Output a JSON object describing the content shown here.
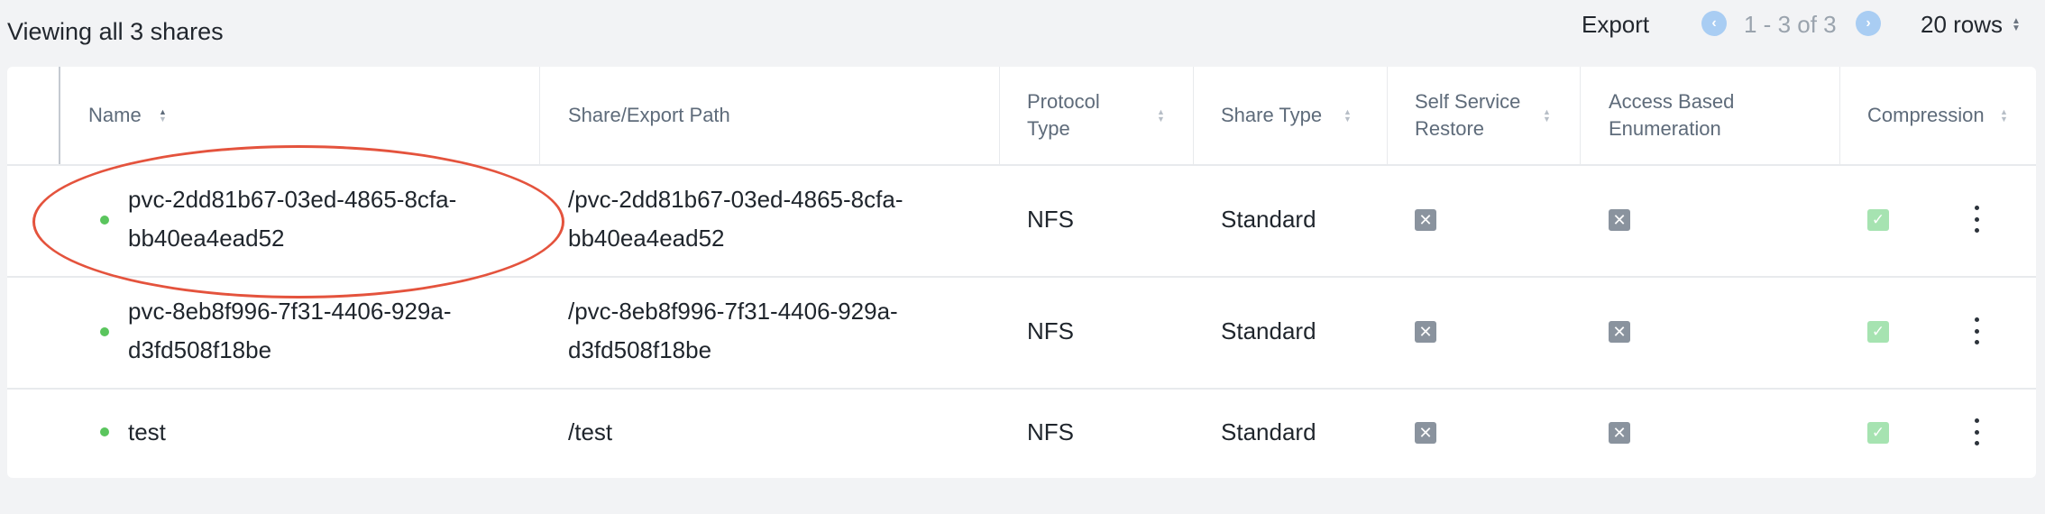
{
  "header": {
    "title": "Viewing all 3 shares",
    "export_label": "Export",
    "page_info": "1 - 3 of 3",
    "rows_label": "20 rows",
    "prev_icon": "chevron-left-icon",
    "next_icon": "chevron-right-icon"
  },
  "table": {
    "columns": [
      {
        "key": "name",
        "label": "Name",
        "sorted": "ascending"
      },
      {
        "key": "path",
        "label": "Share/Export Path"
      },
      {
        "key": "protocol",
        "label": "Protocol Type"
      },
      {
        "key": "share_type",
        "label": "Share Type"
      },
      {
        "key": "ssr",
        "label": "Self Service Restore"
      },
      {
        "key": "abe",
        "label": "Access Based Enumeration"
      },
      {
        "key": "compression",
        "label": "Compression"
      }
    ],
    "rows": [
      {
        "status": "active",
        "name_line1": "pvc-2dd81b67-03ed-4865-8cfa-",
        "name_line2": "bb40ea4ead52",
        "path_line1": "/pvc-2dd81b67-03ed-4865-8cfa-",
        "path_line2": "bb40ea4ead52",
        "protocol": "NFS",
        "share_type": "Standard",
        "ssr": false,
        "abe": false,
        "compression": true
      },
      {
        "status": "active",
        "name_line1": "pvc-8eb8f996-7f31-4406-929a-",
        "name_line2": "d3fd508f18be",
        "path_line1": "/pvc-8eb8f996-7f31-4406-929a-",
        "path_line2": "d3fd508f18be",
        "protocol": "NFS",
        "share_type": "Standard",
        "ssr": false,
        "abe": false,
        "compression": true
      },
      {
        "status": "active",
        "name_line1": "test",
        "path_line1": "/test",
        "protocol": "NFS",
        "share_type": "Standard",
        "ssr": false,
        "abe": false,
        "compression": true
      }
    ]
  },
  "colors": {
    "status_active": "#5ac55d",
    "annotation": "#e4533d",
    "disabled_box": "#8a939e",
    "enabled_box": "#a6e3b1",
    "pager_button": "#a9cdf3"
  }
}
